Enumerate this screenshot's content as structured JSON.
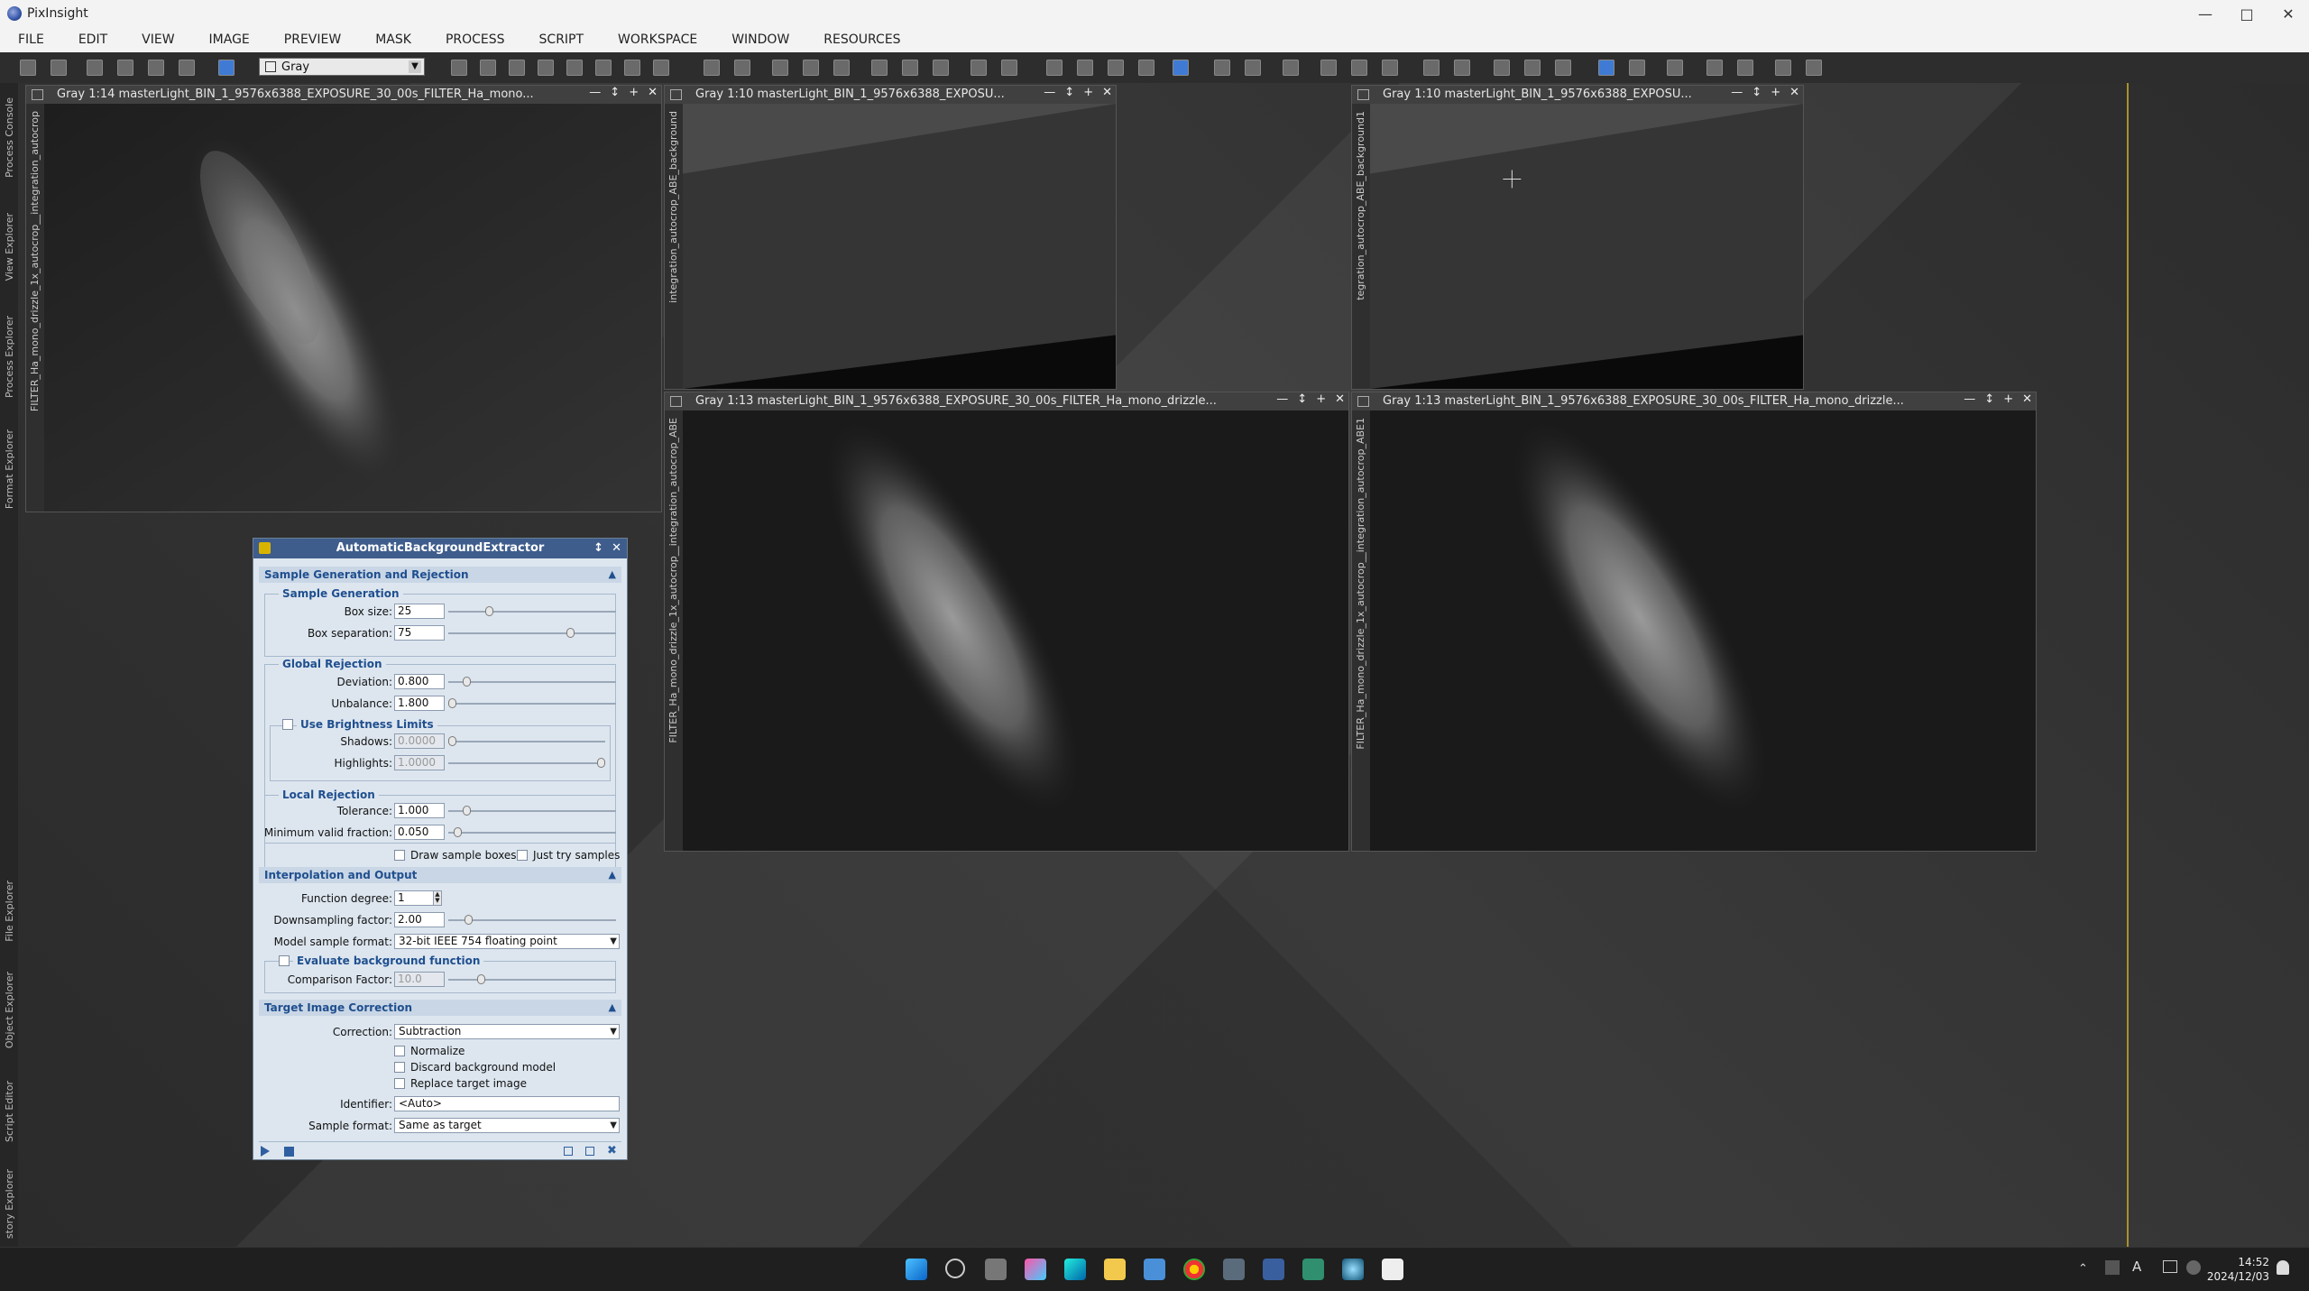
{
  "app": {
    "title": "PixInsight"
  },
  "menu": [
    "FILE",
    "EDIT",
    "VIEW",
    "IMAGE",
    "PREVIEW",
    "MASK",
    "PROCESS",
    "SCRIPT",
    "WORKSPACE",
    "WINDOW",
    "RESOURCES"
  ],
  "toolbar": {
    "view_select": "Gray"
  },
  "sidebar_tabs": {
    "process_console": "Process Console",
    "view_explorer": "View Explorer",
    "process_explorer": "Process Explorer",
    "format_explorer": "Format Explorer",
    "file_explorer": "File Explorer",
    "object_explorer": "Object Explorer",
    "script_editor": "Script Editor",
    "history_explorer": "story Explorer"
  },
  "windows": {
    "w1": {
      "title": "Gray 1:14 masterLight_BIN_1_9576x6388_EXPOSURE_30_00s_FILTER_Ha_mono...",
      "id": "FILTER_Ha_mono_drizzle_1x_autocrop__integration_autocrop"
    },
    "w2": {
      "title": "Gray 1:10 masterLight_BIN_1_9576x6388_EXPOSU...",
      "id": "integration_autocrop_ABE_background"
    },
    "w3": {
      "title": "Gray 1:10 masterLight_BIN_1_9576x6388_EXPOSU...",
      "id": "tegration_autocrop_ABE_background1"
    },
    "w4": {
      "title": "Gray 1:13 masterLight_BIN_1_9576x6388_EXPOSURE_30_00s_FILTER_Ha_mono_drizzle...",
      "id": "FILTER_Ha_mono_drizzle_1x_autocrop__integration_autocrop_ABE"
    },
    "w5": {
      "title": "Gray 1:13 masterLight_BIN_1_9576x6388_EXPOSURE_30_00s_FILTER_Ha_mono_drizzle...",
      "id": "FILTER_Ha_mono_drizzle_1x_autocrop__integration_autocrop_ABE1"
    }
  },
  "abe": {
    "title": "AutomaticBackgroundExtractor",
    "sec1": "Sample Generation and Rejection",
    "g_sample": "Sample Generation",
    "box_size_label": "Box size:",
    "box_size": "25",
    "box_sep_label": "Box separation:",
    "box_sep": "75",
    "g_global": "Global Rejection",
    "deviation_label": "Deviation:",
    "deviation": "0.800",
    "unbalance_label": "Unbalance:",
    "unbalance": "1.800",
    "g_brightness": "Use Brightness Limits",
    "shadows_label": "Shadows:",
    "shadows": "0.0000",
    "highlights_label": "Highlights:",
    "highlights": "1.0000",
    "g_local": "Local Rejection",
    "tolerance_label": "Tolerance:",
    "tolerance": "1.000",
    "min_valid_label": "Minimum valid fraction:",
    "min_valid": "0.050",
    "draw_boxes": "Draw sample boxes",
    "just_try": "Just try samples",
    "sec2": "Interpolation and Output",
    "func_degree_label": "Function degree:",
    "func_degree": "1",
    "downsampling_label": "Downsampling factor:",
    "downsampling": "2.00",
    "model_format_label": "Model sample format:",
    "model_format": "32-bit IEEE 754 floating point",
    "g_evaluate": "Evaluate background function",
    "comparison_label": "Comparison Factor:",
    "comparison": "10.0",
    "sec3": "Target Image Correction",
    "correction_label": "Correction:",
    "correction": "Subtraction",
    "normalize": "Normalize",
    "discard": "Discard background model",
    "replace": "Replace target image",
    "identifier_label": "Identifier:",
    "identifier": "<Auto>",
    "sample_format_label": "Sample format:",
    "sample_format": "Same as target",
    "values": {
      "box_size": 25,
      "box_sep": 75,
      "deviation": 0.8,
      "unbalance": 1.8,
      "shadows": 0.0,
      "highlights": 1.0,
      "tolerance": 1.0,
      "min_valid": 0.05,
      "downsampling": 2.0,
      "comparison": 10.0
    }
  },
  "clock": {
    "time": "14:52",
    "date": "2024/12/03"
  },
  "colors": {
    "accent": "#3e5d8c",
    "section_text": "#1f4f8f",
    "desktop_line": "#a8922c"
  }
}
